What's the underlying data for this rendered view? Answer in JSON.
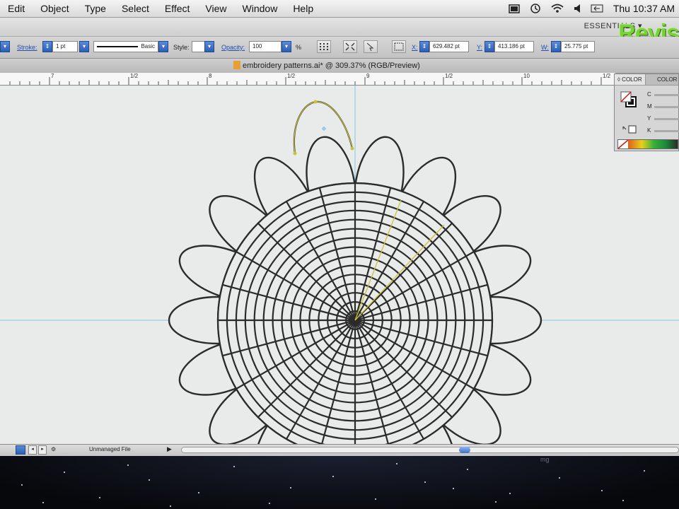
{
  "menubar": {
    "items": [
      "Edit",
      "Object",
      "Type",
      "Select",
      "Effect",
      "View",
      "Window",
      "Help"
    ],
    "clock": "Thu 10:37 AM"
  },
  "appbar": {
    "workspace": "ESSENTIALS ▾",
    "watermark": "Revis"
  },
  "control": {
    "stroke_label": "Stroke:",
    "stroke_value": "1 pt",
    "brush_label": "Basic",
    "style_label": "Style:",
    "opacity_label": "Opacity:",
    "opacity_value": "100",
    "opacity_unit": "%",
    "x_label": "X:",
    "x_value": "629.482 pt",
    "y_label": "Y:",
    "y_value": "413.186 pt",
    "w_label": "W:",
    "w_value": "25.775 pt"
  },
  "document": {
    "tab_title": "embroidery patterns.ai* @ 309.37% (RGB/Preview)"
  },
  "ruler": {
    "ticks": [
      "7",
      "1/2",
      "8",
      "1/2",
      "9",
      "1/2",
      "10",
      "1/2"
    ]
  },
  "color_panel": {
    "tab_color": "◊ COLOR",
    "tab_guide": "COLOR",
    "c_label": "C",
    "m_label": "M",
    "y_label": "Y",
    "k_label": "K"
  },
  "statusbar": {
    "file_status": "Unmanaged File"
  },
  "dock": {
    "label": "mg"
  },
  "colors": {
    "path_stroke": "#2b2b2b",
    "guide": "#7ec8e3",
    "selection": "#c9c23a",
    "canvas": "#e9ebeb"
  }
}
